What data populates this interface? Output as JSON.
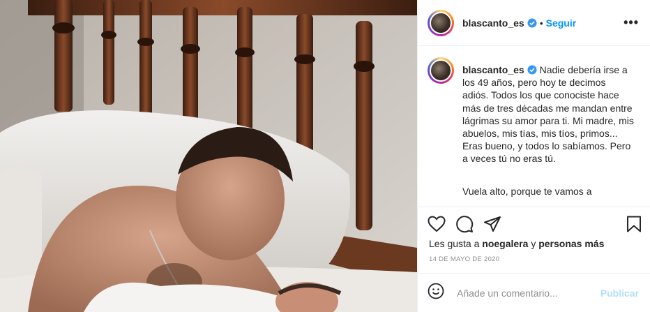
{
  "post": {
    "photo_alt": "Foto de un hombre durmiendo junto a un bebé",
    "header": {
      "username": "blascanto_es",
      "separator": "•",
      "follow_label": "Seguir",
      "more_label": "•••"
    },
    "caption": {
      "username": "blascanto_es",
      "text": "Nadie debería irse a los 49 años, pero hoy te decimos adiós. Todos los que conociste hace más de tres décadas me mandan entre lágrimas su amor para ti. Mi madre, mis abuelos, mis tías, mis tíos, primos... Eras bueno, y todos lo sabíamos. Pero a veces tú no eras tú.",
      "text2": "Vuela alto, porque te vamos a"
    },
    "likes": {
      "prefix": "Les gusta a",
      "user": "noegalera",
      "conj": "y",
      "others": "personas más"
    },
    "date": "14 DE MAYO DE 2020",
    "comment": {
      "placeholder": "Añade un comentario...",
      "publish_label": "Publicar"
    }
  },
  "colors": {
    "link_blue": "#0095f6",
    "publish_disabled": "#b2dffc",
    "muted": "#8e8e8e",
    "text": "#262626",
    "verified": "#3897f0"
  },
  "icons": [
    "verified-badge-icon",
    "heart-icon",
    "comment-icon",
    "share-icon",
    "bookmark-icon",
    "emoji-icon",
    "more-options-icon"
  ]
}
